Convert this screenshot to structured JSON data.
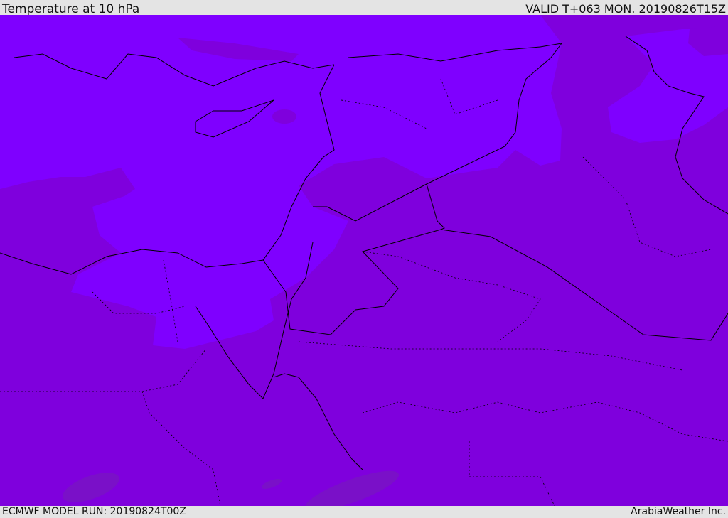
{
  "header": {
    "title": "Temperature at 10 hPa",
    "valid": "VALID T+063 MON. 20190826T15Z"
  },
  "footer": {
    "model_run": "ECMWF MODEL RUN: 20190824T00Z",
    "credit": "ArabiaWeather Inc."
  },
  "colors": {
    "warm_zone": "#7f00ff",
    "cool_zone": "#7f00dd",
    "cooler_patch": "#7a10c8",
    "border": "#000000"
  }
}
